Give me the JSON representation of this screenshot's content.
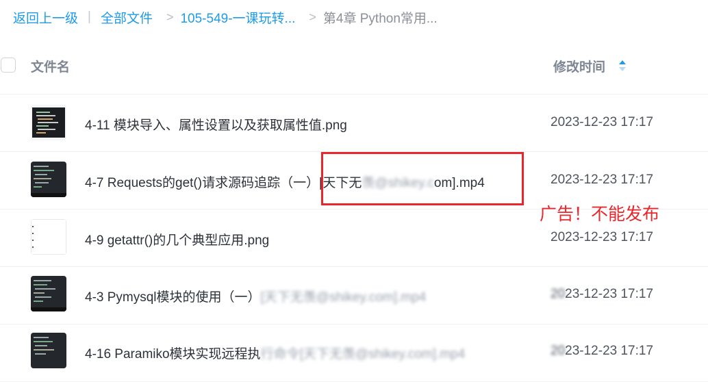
{
  "breadcrumb": {
    "back": "返回上一级",
    "separator": "|",
    "root": "全部文件",
    "arrow": ">",
    "folder": "105-549-一课玩转...",
    "current": "第4章 Python常用..."
  },
  "table": {
    "col_name": "文件名",
    "col_time": "修改时间"
  },
  "files": [
    {
      "name": "4-11 模块导入、属性设置以及获取属性值.png",
      "blurred": "",
      "date": "2023-12-23 17:17",
      "date_blurred": "",
      "thumb": "dark-code"
    },
    {
      "name": "4-7 Requests的get()请求源码追踪（一）[天下无",
      "blurred": "羡@shikey.c",
      "name_tail": "om].mp4",
      "date": "2023-12-23 17:17",
      "date_blurred": "",
      "thumb": "dark-video"
    },
    {
      "name": "4-9 getattr()的几个典型应用.png",
      "blurred": "",
      "date": "2023-12-23 17:17",
      "date_blurred": "",
      "thumb": "white-doc"
    },
    {
      "name": "4-3 Pymysql模块的使用（一）",
      "blurred": "[天下无羡@shikey.com].mp4",
      "date": "23-12-23 17:17",
      "date_blurred": "20",
      "thumb": "dark-video"
    },
    {
      "name": "4-16 Paramiko模块实现远程执",
      "blurred": "行命令[天下无羡@shikey.com].mp4",
      "date": "23-12-23 17:17",
      "date_blurred": "20",
      "thumb": "dark-video"
    }
  ],
  "annotation": {
    "text": "广告！不能发布",
    "color": "#e8262c"
  },
  "colors": {
    "link": "#1e9be8",
    "sort_active": "#1e9be8",
    "sort_inactive": "#b7d9f5"
  }
}
